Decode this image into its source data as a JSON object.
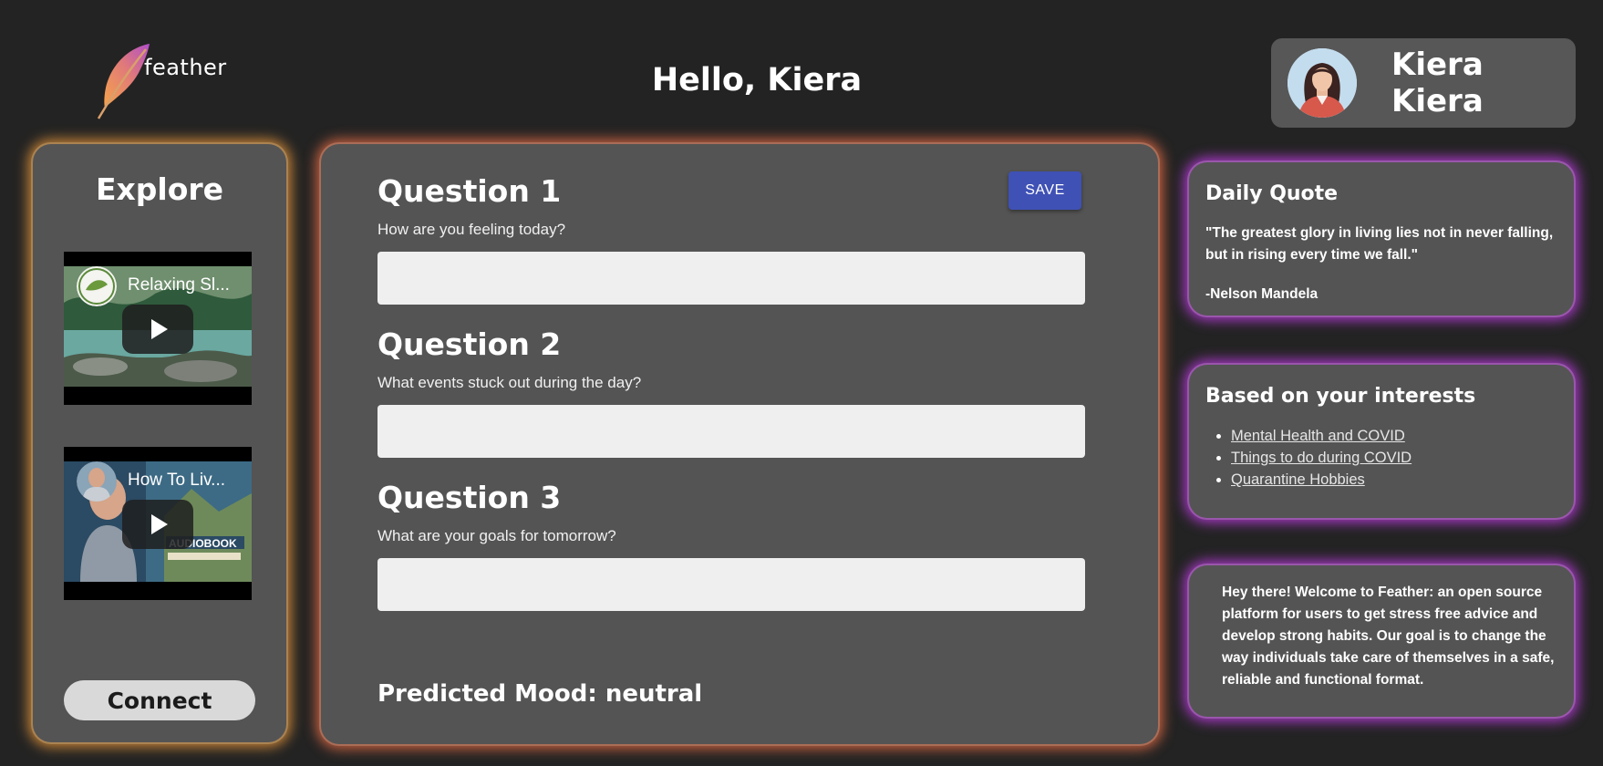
{
  "header": {
    "logo_text": "feather",
    "greeting": "Hello, Kiera",
    "user_name": "Kiera Kiera"
  },
  "explore": {
    "title": "Explore",
    "videos": [
      {
        "title": "Relaxing Sl..."
      },
      {
        "title": "How To Liv..."
      }
    ],
    "connect_label": "Connect"
  },
  "journal": {
    "save_label": "SAVE",
    "questions": [
      {
        "title": "Question 1",
        "prompt": "How are you feeling today?",
        "value": ""
      },
      {
        "title": "Question 2",
        "prompt": "What events stuck out during the day?",
        "value": ""
      },
      {
        "title": "Question 3",
        "prompt": "What are your goals for tomorrow?",
        "value": ""
      }
    ],
    "predicted_mood": "Predicted Mood: neutral"
  },
  "daily_quote": {
    "title": "Daily Quote",
    "text": "\"The greatest glory in living lies not in never falling, but in rising every time we fall.\"",
    "author": "-Nelson Mandela"
  },
  "interests": {
    "title": "Based on your interests",
    "links": [
      "Mental Health and COVID",
      "Things to do during COVID",
      "Quarantine Hobbies"
    ]
  },
  "welcome": {
    "text": "Hey there! Welcome to Feather: an open source platform for users to get stress free advice and develop strong habits. Our goal is to change the way individuals take care of themselves in a safe, reliable and functional format."
  },
  "colors": {
    "background": "#232323",
    "panel": "#545454",
    "explore_glow": "#e8963c",
    "journal_glow": "#e86e46",
    "card_glow": "#b93cdc",
    "save_button": "#3f51b5",
    "input_fill": "#efefef"
  },
  "icons": [
    "feather-logo-icon",
    "avatar-icon",
    "play-icon"
  ]
}
